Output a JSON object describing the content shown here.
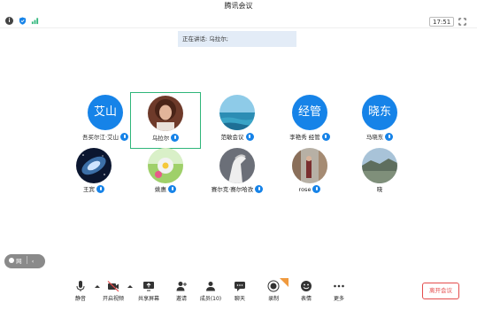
{
  "window": {
    "title": "腾讯会议"
  },
  "status": {
    "clock": "17:51"
  },
  "speaker": {
    "text": "正在讲话: 乌拉尔;"
  },
  "participants_row1": [
    {
      "name": "吾买尔江·艾山",
      "avatar_text": "艾山",
      "avatar_type": "text"
    },
    {
      "name": "乌拉尔",
      "avatar_type": "photo-person",
      "active": true
    },
    {
      "name": "范敏会议",
      "avatar_type": "photo-sea"
    },
    {
      "name": "李艳秀 经管",
      "avatar_text": "经管",
      "avatar_type": "text"
    },
    {
      "name": "马晓东",
      "avatar_text": "晓东",
      "avatar_type": "text"
    }
  ],
  "participants_row2": [
    {
      "name": "王宾",
      "avatar_type": "photo-galaxy"
    },
    {
      "name": "姚惠",
      "avatar_type": "photo-flower"
    },
    {
      "name": "赛尔克·赛尔哈孜",
      "avatar_type": "photo-horse"
    },
    {
      "name": "rose",
      "avatar_type": "photo-street"
    },
    {
      "name": "晓",
      "avatar_type": "photo-landscape"
    }
  ],
  "pill": {
    "label": "网"
  },
  "toolbar": {
    "mute": "静音",
    "video": "开启视频",
    "share": "共享屏幕",
    "invite": "邀请",
    "members": "成员(10)",
    "chat": "聊天",
    "record": "录制",
    "reactions": "表情",
    "more": "更多"
  },
  "leave": {
    "label": "离开会议"
  },
  "colors": {
    "accent": "#1683e8",
    "active_border": "#2fb67a",
    "leave": "#e44c4c"
  }
}
